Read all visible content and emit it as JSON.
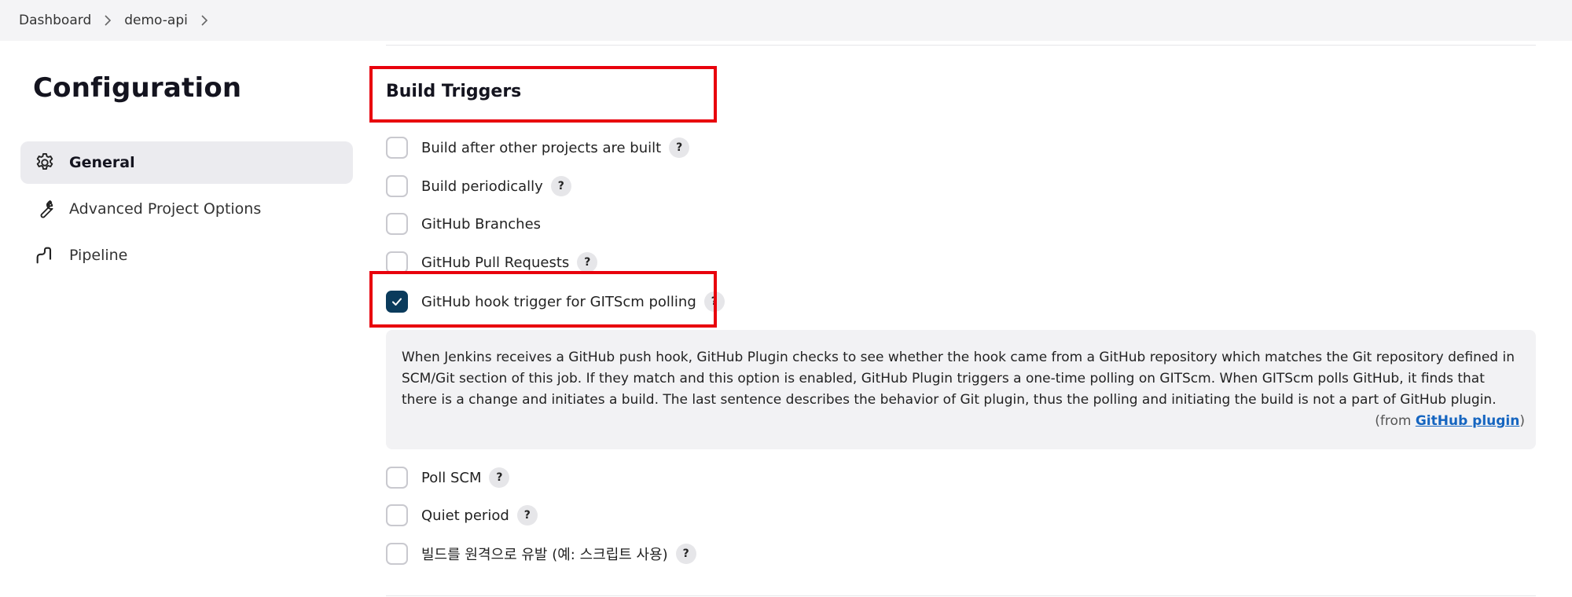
{
  "breadcrumb": {
    "items": [
      "Dashboard",
      "demo-api"
    ]
  },
  "sidebar": {
    "title": "Configuration",
    "items": [
      {
        "label": "General",
        "icon": "gear-icon",
        "active": true
      },
      {
        "label": "Advanced Project Options",
        "icon": "wrench-icon",
        "active": false
      },
      {
        "label": "Pipeline",
        "icon": "pipeline-icon",
        "active": false
      }
    ]
  },
  "build_triggers": {
    "title": "Build Triggers",
    "options": [
      {
        "label": "Build after other projects are built",
        "checked": false,
        "help": "?"
      },
      {
        "label": "Build periodically",
        "checked": false,
        "help": "?"
      },
      {
        "label": "GitHub Branches",
        "checked": false
      },
      {
        "label": "GitHub Pull Requests",
        "checked": false,
        "help": "?"
      },
      {
        "label": "GitHub hook trigger for GITScm polling",
        "checked": true,
        "help": "?"
      },
      {
        "label": "Poll SCM",
        "checked": false,
        "help": "?"
      },
      {
        "label": "Quiet period",
        "checked": false,
        "help": "?"
      },
      {
        "label": "빌드를 원격으로 유발 (예: 스크립트 사용)",
        "checked": false,
        "help": "?"
      }
    ],
    "help_panel": {
      "text": "When Jenkins receives a GitHub push hook, GitHub Plugin checks to see whether the hook came from a GitHub repository which matches the Git repository defined in SCM/Git section of this job. If they match and this option is enabled, GitHub Plugin triggers a one-time polling on GITScm. When GITScm polls GitHub, it finds that there is a change and initiates a build. The last sentence describes the behavior of Git plugin, thus the polling and initiating the build is not a part of GitHub plugin.",
      "source_prefix": "(from ",
      "source_link": "GitHub plugin",
      "source_suffix": ")"
    }
  },
  "colors": {
    "accent": "#0b3b5c",
    "highlight": "#e8000c",
    "link": "#1565c0"
  }
}
